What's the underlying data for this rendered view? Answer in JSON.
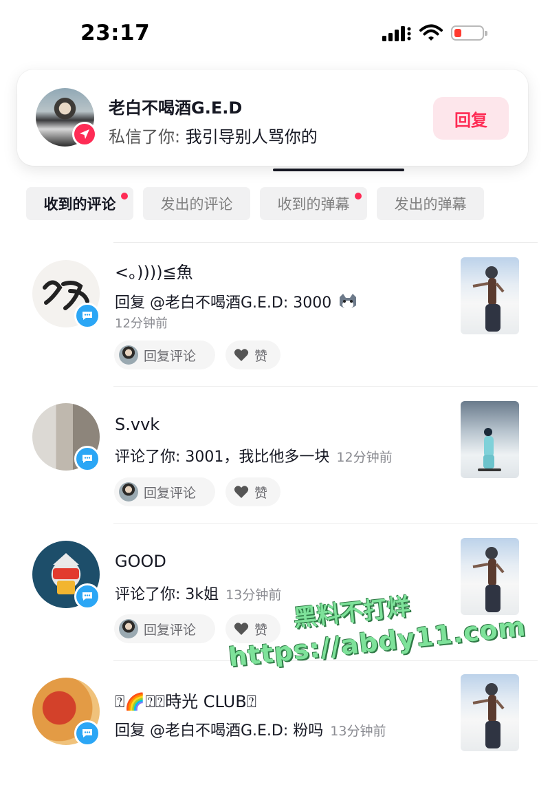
{
  "status_bar": {
    "time": "23:17"
  },
  "notification": {
    "sender": "老白不喝酒G.E.D",
    "message_prefix": "私信了你: ",
    "message_text": "我引导别人骂你的",
    "reply_label": "回复"
  },
  "filters": [
    {
      "label": "收到的评论",
      "active": true,
      "dot": true
    },
    {
      "label": "发出的评论",
      "active": false,
      "dot": false
    },
    {
      "label": "收到的弹幕",
      "active": false,
      "dot": true
    },
    {
      "label": "发出的弹幕",
      "active": false,
      "dot": false
    }
  ],
  "comments": [
    {
      "name": "<。))))≦魚",
      "content": "回复 @老白不喝酒G.E.D: 3000",
      "time": "12分钟前",
      "reply_label": "回复评论",
      "like_label": "赞"
    },
    {
      "name": "S.vvk",
      "content": "评论了你: 3001，我比他多一块",
      "time": "12分钟前",
      "reply_label": "回复评论",
      "like_label": "赞"
    },
    {
      "name": "GOOD",
      "content": "评论了你: 3k姐",
      "time": "13分钟前",
      "reply_label": "回复评论",
      "like_label": "赞"
    },
    {
      "name": "⍰🌈⍰⍰時光 CLUB⍰",
      "content": "回复 @老白不喝酒G.E.D: 粉吗",
      "time": "13分钟前"
    }
  ],
  "watermark": {
    "line1": "黑料不打烊",
    "line2": "https://abdy11.com"
  },
  "colors": {
    "accent": "#fe2c55",
    "badge_blue": "#2ba6f5",
    "watermark_green": "#7ee29a"
  }
}
